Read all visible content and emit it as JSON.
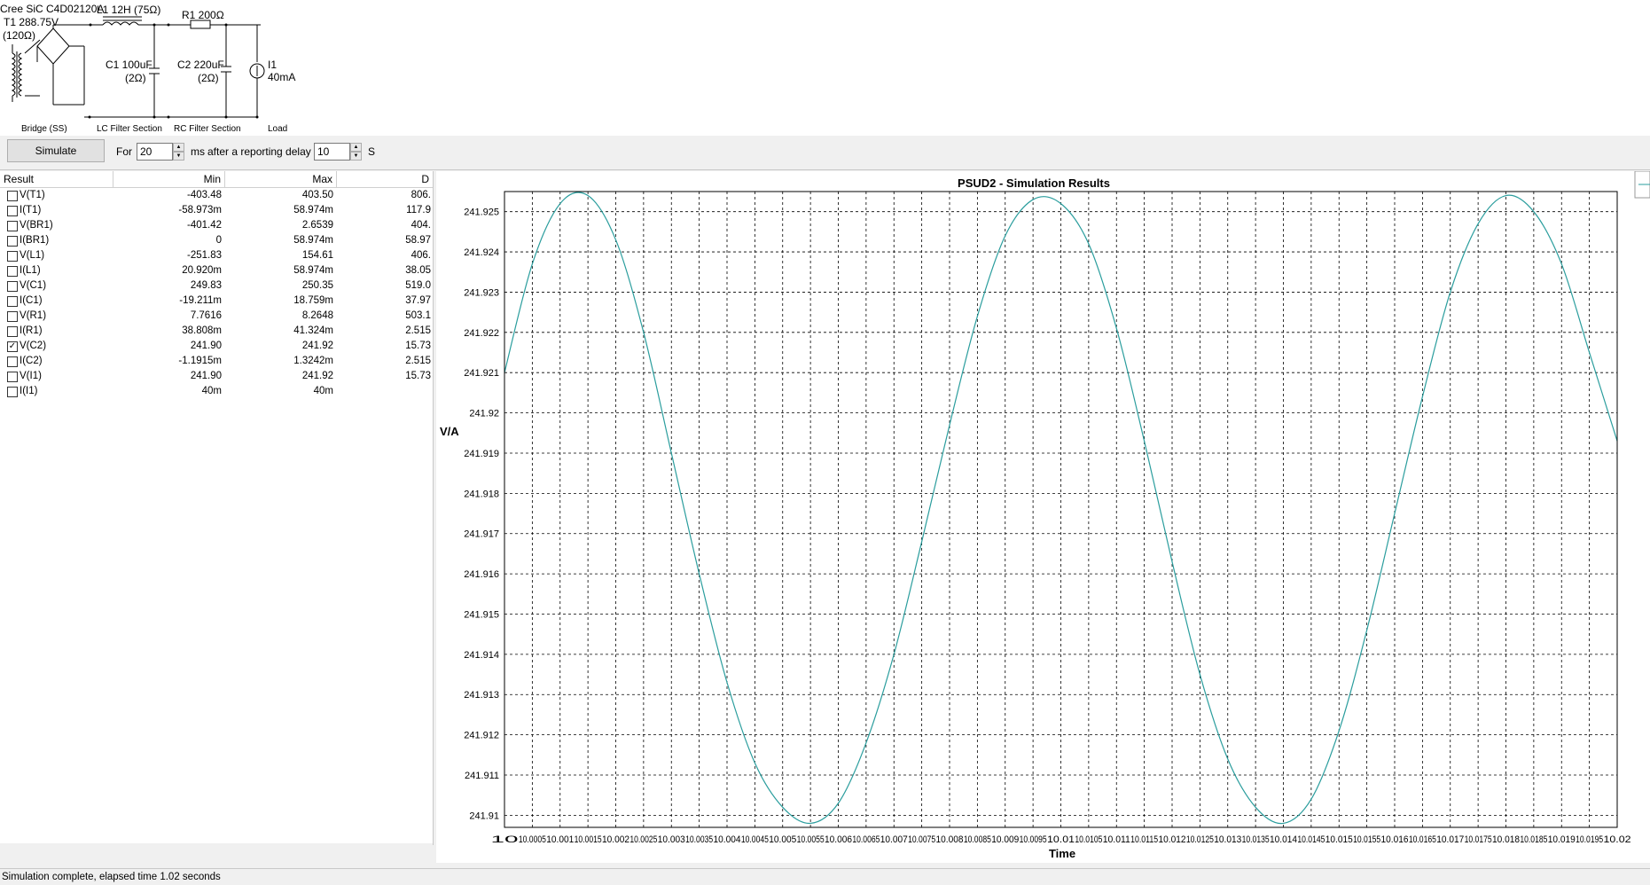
{
  "circuit": {
    "transformer": {
      "line1": "Cree SiC C4D02120A",
      "line2": "T1 288.75V",
      "line3": "(120Ω)"
    },
    "inductor": "L1 12H (75Ω)",
    "resistor": "R1 200Ω",
    "cap1": {
      "line1": "C1 100uF",
      "line2": "(2Ω)"
    },
    "cap2": {
      "line1": "C2 220uF",
      "line2": "(2Ω)"
    },
    "load": {
      "line1": "I1",
      "line2": "40mA"
    },
    "sections": [
      "Bridge (SS)",
      "LC Filter Section",
      "RC Filter Section",
      "Load"
    ]
  },
  "toolbar": {
    "simulate_label": "Simulate",
    "for_label": "For",
    "duration_value": "20",
    "ms_label": "ms",
    "delay_label": "after a reporting delay of",
    "delay_value": "10",
    "s_label": "S"
  },
  "results": {
    "columns": [
      "Result",
      "Min",
      "Max",
      "D"
    ],
    "rows": [
      {
        "name": "V(T1)",
        "min": "-403.48",
        "max": "403.50",
        "delta": "806.",
        "checked": false
      },
      {
        "name": "I(T1)",
        "min": "-58.973m",
        "max": "58.974m",
        "delta": "117.9",
        "checked": false
      },
      {
        "name": "V(BR1)",
        "min": "-401.42",
        "max": "2.6539",
        "delta": "404.",
        "checked": false
      },
      {
        "name": "I(BR1)",
        "min": "0",
        "max": "58.974m",
        "delta": "58.97",
        "checked": false
      },
      {
        "name": "V(L1)",
        "min": "-251.83",
        "max": "154.61",
        "delta": "406.",
        "checked": false
      },
      {
        "name": "I(L1)",
        "min": "20.920m",
        "max": "58.974m",
        "delta": "38.05",
        "checked": false
      },
      {
        "name": "V(C1)",
        "min": "249.83",
        "max": "250.35",
        "delta": "519.0",
        "checked": false
      },
      {
        "name": "I(C1)",
        "min": "-19.211m",
        "max": "18.759m",
        "delta": "37.97",
        "checked": false
      },
      {
        "name": "V(R1)",
        "min": "7.7616",
        "max": "8.2648",
        "delta": "503.1",
        "checked": false
      },
      {
        "name": "I(R1)",
        "min": "38.808m",
        "max": "41.324m",
        "delta": "2.515",
        "checked": false
      },
      {
        "name": "V(C2)",
        "min": "241.90",
        "max": "241.92",
        "delta": "15.73",
        "checked": true
      },
      {
        "name": "I(C2)",
        "min": "-1.1915m",
        "max": "1.3242m",
        "delta": "2.515",
        "checked": false
      },
      {
        "name": "V(I1)",
        "min": "241.90",
        "max": "241.92",
        "delta": "15.73",
        "checked": false
      },
      {
        "name": "I(I1)",
        "min": "40m",
        "max": "40m",
        "delta": "",
        "checked": false
      }
    ],
    "scroll_right_glyph": "›"
  },
  "chart_data": {
    "type": "line",
    "title": "PSUD2 - Simulation Results",
    "xlabel": "Time",
    "ylabel": "V/A",
    "xlim": [
      10,
      10.02
    ],
    "ylim": [
      241.9097,
      241.9255
    ],
    "grid": true,
    "line_color": "#2a9d9d",
    "x_tick_labels": [
      "10",
      "10.0005",
      "10.001",
      "10.0015",
      "10.002",
      "10.0025",
      "10.003",
      "10.0035",
      "10.004",
      "10.0045",
      "10.005",
      "10.0055",
      "10.006",
      "10.0065",
      "10.007",
      "10.0075",
      "10.008",
      "10.0085",
      "10.009",
      "10.0095",
      "10.01",
      "10.0105",
      "10.011",
      "10.0115",
      "10.012",
      "10.0125",
      "10.013",
      "10.0135",
      "10.014",
      "10.0145",
      "10.015",
      "10.0155",
      "10.016",
      "10.0165",
      "10.017",
      "10.0175",
      "10.018",
      "10.0185",
      "10.019",
      "10.0195",
      "10.02"
    ],
    "y_tick_labels": [
      "241.925",
      "241.924",
      "241.923",
      "241.922",
      "241.921",
      "241.92",
      "241.919",
      "241.918",
      "241.917",
      "241.916",
      "241.915",
      "241.914",
      "241.913",
      "241.912",
      "241.911",
      "241.91"
    ],
    "y_tick_values": [
      241.925,
      241.924,
      241.923,
      241.922,
      241.921,
      241.92,
      241.919,
      241.918,
      241.917,
      241.916,
      241.915,
      241.914,
      241.913,
      241.912,
      241.911,
      241.91
    ],
    "series": [
      {
        "values_x": [
          10,
          10.0005,
          10.001,
          10.0015,
          10.002,
          10.0025,
          10.003,
          10.0035,
          10.004,
          10.0045,
          10.005,
          10.0055,
          10.006,
          10.0065,
          10.007,
          10.0075,
          10.008,
          10.0085,
          10.009,
          10.0095,
          10.01,
          10.0105,
          10.011,
          10.0115,
          10.012,
          10.0125,
          10.013,
          10.0135,
          10.014,
          10.0145,
          10.015,
          10.0155,
          10.016,
          10.0165,
          10.017,
          10.0175,
          10.018,
          10.0185,
          10.019,
          10.0195,
          10.02
        ],
        "values_y": [
          241.921,
          241.9237,
          241.9252,
          241.9254,
          241.9243,
          241.922,
          241.919,
          241.916,
          241.9133,
          241.9113,
          241.9102,
          241.9098,
          241.9103,
          241.9118,
          241.914,
          241.9168,
          241.9197,
          241.9224,
          241.9244,
          241.9253,
          241.9252,
          241.9242,
          241.9221,
          241.9193,
          241.9163,
          241.9135,
          241.9114,
          241.9102,
          241.9098,
          241.9104,
          241.9121,
          241.9146,
          241.9175,
          241.9204,
          241.923,
          241.9247,
          241.9254,
          241.925,
          241.9237,
          241.9215,
          241.9193
        ]
      }
    ]
  },
  "status": {
    "text": "Simulation complete, elapsed time 1.02 seconds"
  }
}
